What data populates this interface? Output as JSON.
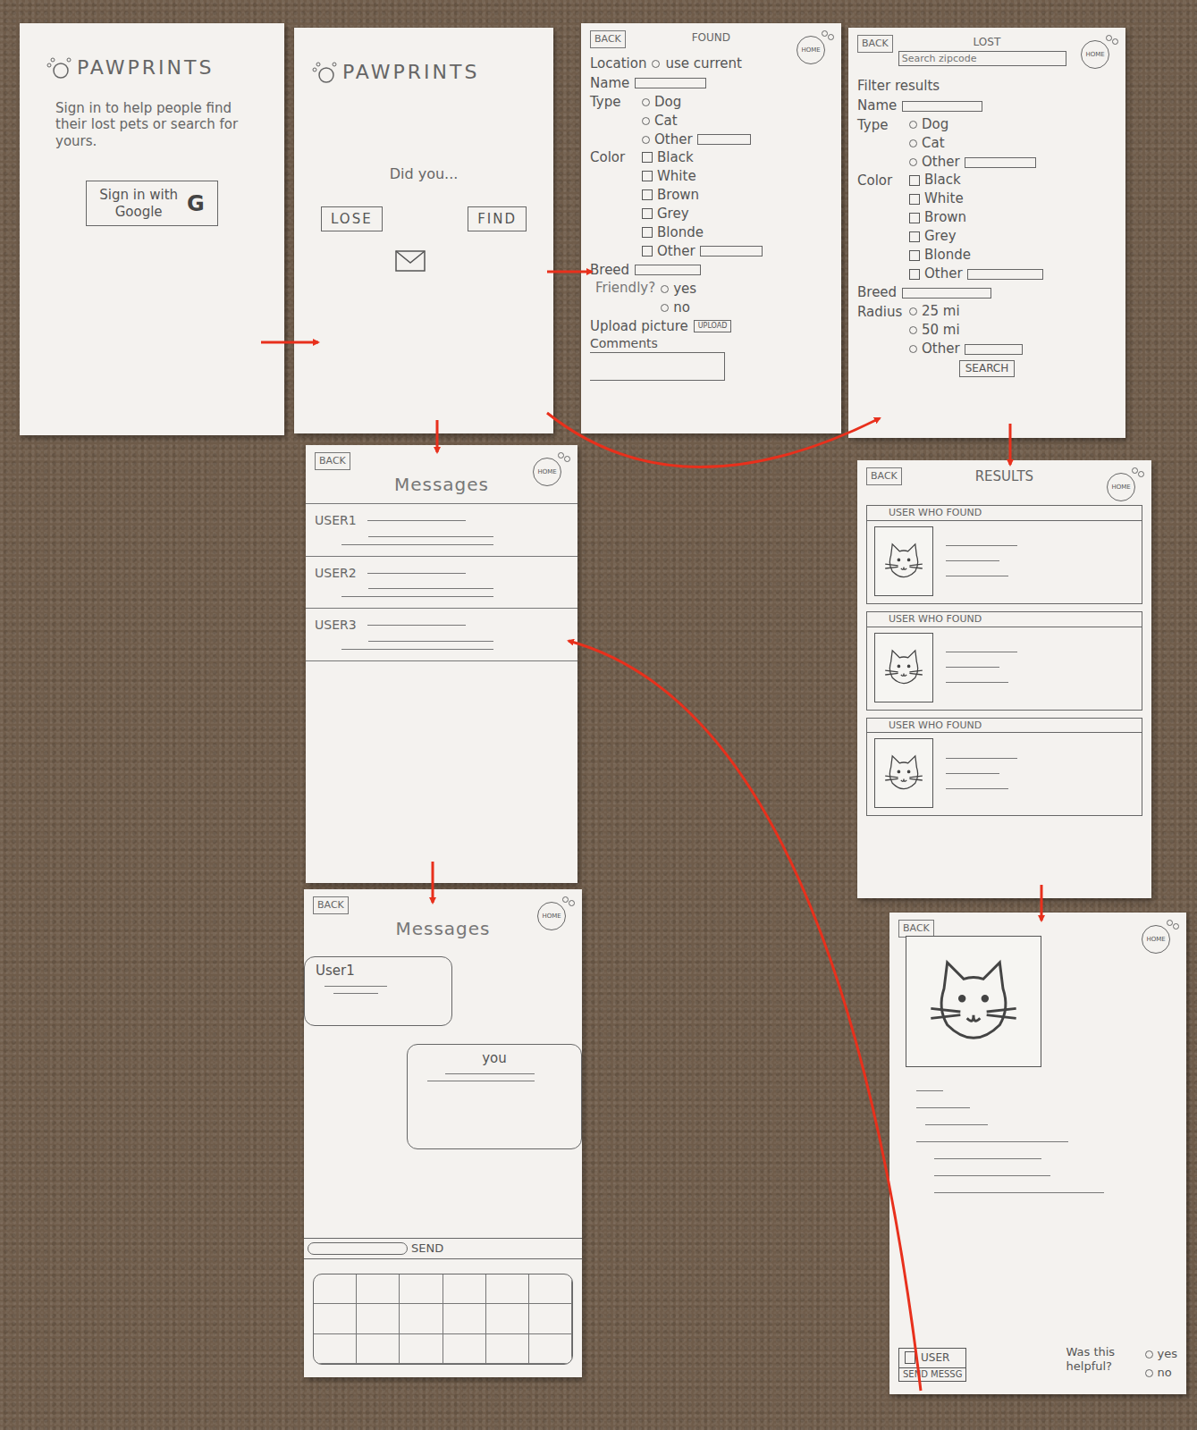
{
  "screens": {
    "signin": {
      "logo": "PAWPRINTS",
      "tagline": "Sign in to help people find their lost pets or search for yours.",
      "button": "Sign in with",
      "button_brand": "Google",
      "g": "G"
    },
    "home": {
      "logo": "PAWPRINTS",
      "prompt": "Did you...",
      "lose": "LOSE",
      "find": "FIND"
    },
    "found": {
      "back": "BACK",
      "title": "FOUND",
      "home": "HOME",
      "location": "Location",
      "use_current": {
        "label": "use current",
        "selected": false
      },
      "name": "Name",
      "type_label": "Type",
      "types": [
        {
          "label": "Dog",
          "selected": false,
          "kind": "plain"
        },
        {
          "label": "Cat",
          "selected": false,
          "kind": "plain"
        },
        {
          "label": "Other",
          "selected": false,
          "kind": "field"
        }
      ],
      "color_label": "Color",
      "colors": [
        {
          "label": "Black",
          "checked": false,
          "kind": "plain"
        },
        {
          "label": "White",
          "checked": false,
          "kind": "plain"
        },
        {
          "label": "Brown",
          "checked": false,
          "kind": "plain"
        },
        {
          "label": "Grey",
          "checked": false,
          "kind": "plain"
        },
        {
          "label": "Blonde",
          "checked": false,
          "kind": "plain"
        },
        {
          "label": "Other",
          "checked": false,
          "kind": "field"
        }
      ],
      "breed": "Breed",
      "friendly_label": "Friendly?",
      "friendly": [
        {
          "label": "yes",
          "selected": false
        },
        {
          "label": "no",
          "selected": false
        }
      ],
      "upload_label": "Upload picture",
      "upload_button": "UPLOAD",
      "comments": "Comments"
    },
    "lost": {
      "back": "BACK",
      "title": "LOST",
      "home": "HOME",
      "search_placeholder": "Search zipcode",
      "filter": "Filter results",
      "name": "Name",
      "type_label": "Type",
      "types": [
        {
          "label": "Dog",
          "selected": false,
          "kind": "plain"
        },
        {
          "label": "Cat",
          "selected": false,
          "kind": "plain"
        },
        {
          "label": "Other",
          "selected": false,
          "kind": "field"
        }
      ],
      "color_label": "Color",
      "colors": [
        {
          "label": "Black",
          "checked": false,
          "kind": "plain"
        },
        {
          "label": "White",
          "checked": false,
          "kind": "plain"
        },
        {
          "label": "Brown",
          "checked": false,
          "kind": "plain"
        },
        {
          "label": "Grey",
          "checked": false,
          "kind": "plain"
        },
        {
          "label": "Blonde",
          "checked": false,
          "kind": "plain"
        },
        {
          "label": "Other",
          "checked": false,
          "kind": "field"
        }
      ],
      "breed": "Breed",
      "radius_label": "Radius",
      "radius": [
        {
          "label": "25 mi",
          "selected": false,
          "kind": "plain"
        },
        {
          "label": "50 mi",
          "selected": false,
          "kind": "plain"
        },
        {
          "label": "Other",
          "selected": false,
          "kind": "field"
        }
      ],
      "search_button": "SEARCH"
    },
    "messages": {
      "back": "BACK",
      "title": "Messages",
      "home": "HOME",
      "threads": [
        "USER1",
        "USER2",
        "USER3"
      ]
    },
    "results": {
      "back": "BACK",
      "title": "RESULTS",
      "home": "HOME",
      "items": [
        "USER WHO FOUND",
        "USER WHO FOUND",
        "USER WHO FOUND"
      ]
    },
    "chat": {
      "back": "BACK",
      "title": "Messages",
      "home": "HOME",
      "bubbles": [
        {
          "sender": "User1",
          "kind": "incoming"
        },
        {
          "sender": "you",
          "kind": "outgoing"
        }
      ],
      "send": "SEND"
    },
    "detail": {
      "back": "BACK",
      "home": "HOME",
      "user": "USER",
      "send_message": "SEND MESSG",
      "helpful": "Was this helpful?",
      "helpful_options": [
        {
          "label": "yes",
          "selected": false
        },
        {
          "label": "no",
          "selected": false
        }
      ]
    }
  }
}
